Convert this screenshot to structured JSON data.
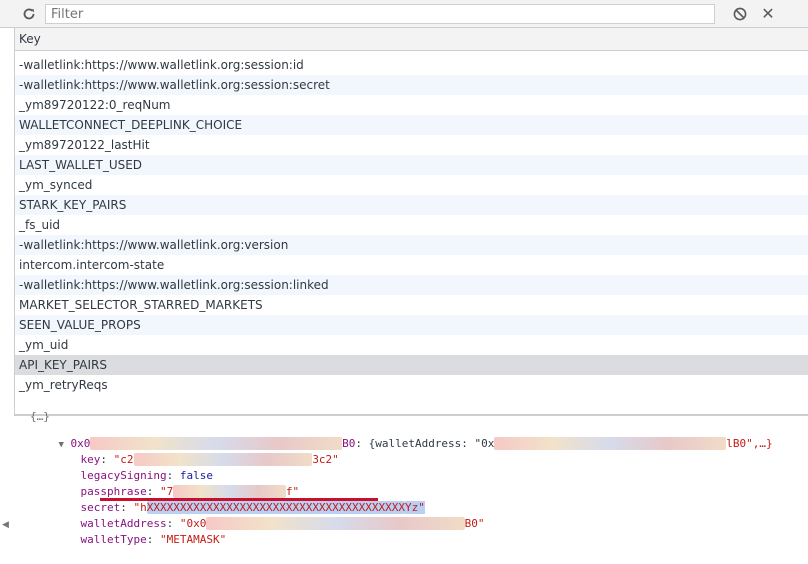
{
  "toolbar": {
    "filter_placeholder": "Filter",
    "icons": [
      "refresh-icon",
      "clear-all-icon",
      "close-icon"
    ],
    "close_glyph": "✕"
  },
  "grid": {
    "column_header": "Key",
    "rows": [
      "-walletlink:https://www.walletlink.org:session:id",
      "-walletlink:https://www.walletlink.org:session:secret",
      "_ym89720122:0_reqNum",
      "WALLETCONNECT_DEEPLINK_CHOICE",
      "_ym89720122_lastHit",
      "LAST_WALLET_USED",
      "_ym_synced",
      "STARK_KEY_PAIRS",
      "_fs_uid",
      "-walletlink:https://www.walletlink.org:version",
      "intercom.intercom-state",
      "-walletlink:https://www.walletlink.org:session:linked",
      "MARKET_SELECTOR_STARRED_MARKETS",
      "SEEN_VALUE_PROPS",
      "_ym_uid",
      "API_KEY_PAIRS",
      "_ym_retryReqs"
    ],
    "selected_index": 15
  },
  "preview": {
    "top_fragment": "{…}",
    "object_prefix": "0x0",
    "object_suffix": "B0",
    "object_summary_start": ": {walletAddress: \"0x",
    "object_summary_end": "lB0\",…}",
    "lines": {
      "key_label": "key",
      "key_value_start": "\"c2",
      "key_value_end": "3c2\"",
      "legacy_label": "legacySigning",
      "legacy_value": "false",
      "passphrase_label": "passphrase",
      "passphrase_value_start": "\"7",
      "passphrase_value_end": "f\"",
      "secret_label": "secret",
      "secret_value_start": "\"h",
      "secret_value_end": "Yz\"",
      "wallet_address_label": "walletAddress",
      "wallet_address_start": "\"0x0",
      "wallet_address_end": "B0\"",
      "wallet_type_label": "walletType",
      "wallet_type_value": "\"METAMASK\""
    }
  },
  "colors": {
    "accent": "#4c8bf5",
    "string": "#c41a16",
    "property": "#c80000",
    "selection_row": "#dadce0",
    "alt_row": "#f2f7fd",
    "underline": "#c8102e"
  }
}
